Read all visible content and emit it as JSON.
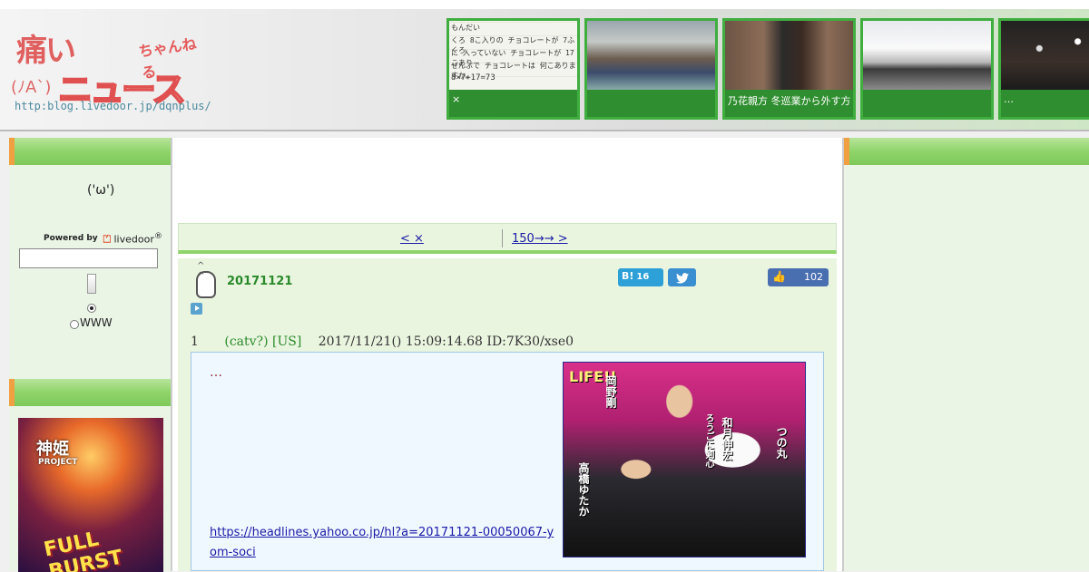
{
  "header": {
    "logo_kanji": "痛い",
    "logo_chan": "ちゃんねる",
    "logo_face": "(ﾉA`)",
    "logo_news": "ニュース",
    "logo_url": "http:blog.livedoor.jp/dqnplus/",
    "thumbnails": [
      {
        "caption": "×",
        "img_text": [
          "もんだい",
          "くろ 8こ入りの チョコレートが 7ふくろ",
          "に 入っていない チョコレートが 17こあり",
          "ぜんぶで チョコレートは 何こありますか。",
          "8×7+17=73"
        ]
      },
      {
        "caption": ""
      },
      {
        "caption": "乃花親方 冬巡業から外す方"
      },
      {
        "caption": ""
      },
      {
        "caption": "…"
      }
    ]
  },
  "sidebar": {
    "face": "('ω')",
    "powered_by": "Powered by",
    "livedoor_mark": "⏍",
    "livedoor": "livedoor",
    "livedoor_reg": "®",
    "search_placeholder": "",
    "radio_site_label": "",
    "radio_www_label": "WWW",
    "banner_title": "神姫",
    "banner_sub": "PROJECT",
    "banner_event": "FULL BURST"
  },
  "pager": {
    "prev_label": "<  ×          ",
    "next_label": "150→→ >       "
  },
  "article": {
    "date": "20171121",
    "hatena_label": "B!",
    "hatena_count": "16",
    "twitter_icon": "twitter-bird",
    "fb_count": "102",
    "res_number": "1",
    "res_name": "(catv?) [US]",
    "res_meta": "2017/11/21() 15:09:14.68 ID:7K30/xse0",
    "res_text": "…",
    "link_text": "https://headlines.yahoo.co.jp/hl?a=20171121-00050067-yom-soci",
    "photo_texts": [
      "LIFE!!",
      "岡野剛",
      "和月伸宏",
      "ろうごに剣心",
      "高橋ゆたか",
      "つの丸"
    ]
  },
  "colors": {
    "accent_green": "#8fd46a",
    "date_green": "#2a8a2a",
    "link_blue": "#1a1aa6",
    "hatena_blue": "#2ea0d8",
    "fb_blue": "#4a6fb0"
  }
}
